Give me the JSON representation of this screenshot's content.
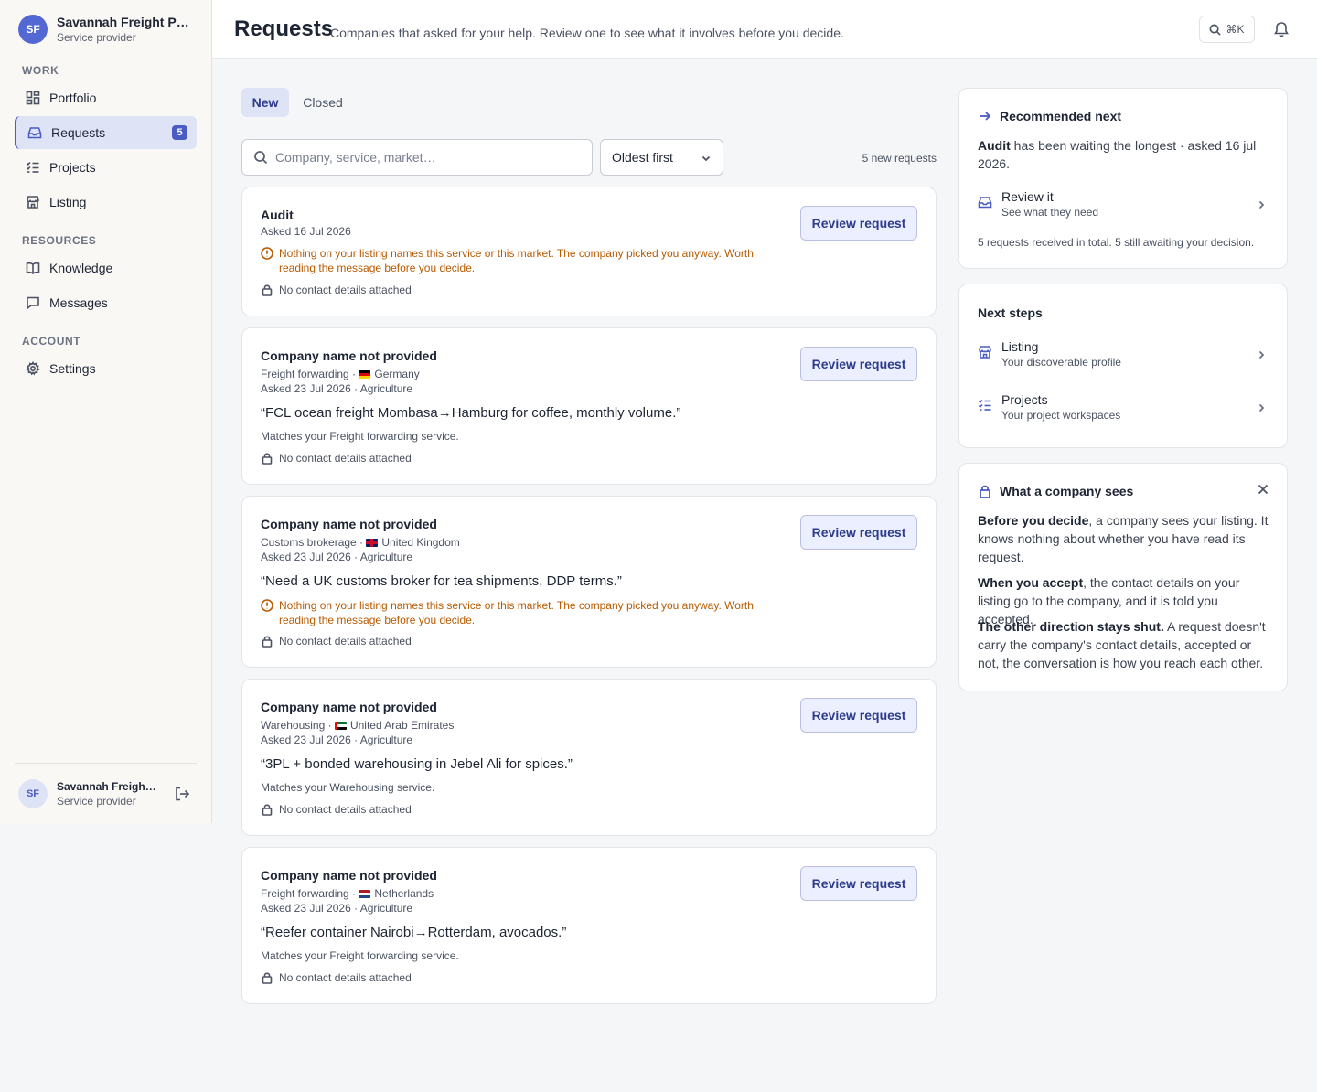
{
  "org": {
    "initials": "SF",
    "name": "Savannah Freight Partners",
    "role": "Service provider"
  },
  "sidebar": {
    "sections": [
      "WORK",
      "RESOURCES",
      "ACCOUNT"
    ],
    "items": [
      {
        "label": "Portfolio",
        "icon": "grid-icon"
      },
      {
        "label": "Requests",
        "icon": "inbox-icon",
        "badge": "5",
        "active": true
      },
      {
        "label": "Projects",
        "icon": "checklist-icon"
      },
      {
        "label": "Listing",
        "icon": "store-icon"
      },
      {
        "label": "Knowledge",
        "icon": "book-icon"
      },
      {
        "label": "Messages",
        "icon": "message-icon"
      },
      {
        "label": "Settings",
        "icon": "gear-icon"
      }
    ]
  },
  "user": {
    "initials": "SF",
    "name": "Savannah Freight Partners",
    "role": "Service provider"
  },
  "header": {
    "title": "Requests",
    "subtitle": "Companies that asked for your help. Review one to see what it involves before you decide.",
    "shortcut": "⌘K"
  },
  "tabs": [
    "New",
    "Closed"
  ],
  "search": {
    "placeholder": "Company, service, market…",
    "value": ""
  },
  "sort": {
    "selected": "Oldest first"
  },
  "count_label": "5 new requests",
  "review_label": "Review request",
  "no_contact": "No contact details attached",
  "warning_text": "Nothing on your listing names this service or this market. The company picked you anyway. Worth reading the message before you decide.",
  "requests": [
    {
      "company": "Audit",
      "asked": "Asked 16 Jul 2026"
    },
    {
      "company": "Company name not provided",
      "service": "Freight forwarding",
      "sep": " · ",
      "country": "Germany",
      "asked": "Asked 23 Jul 2026 · Agriculture",
      "message": "“FCL ocean freight Mombasa→Hamburg for coffee, monthly volume.”",
      "match": "Matches your Freight forwarding service."
    },
    {
      "company": "Company name not provided",
      "service": "Customs brokerage",
      "sep": " · ",
      "country": "United Kingdom",
      "asked": "Asked 23 Jul 2026 · Agriculture",
      "message": "“Need a UK customs broker for tea shipments, DDP terms.”"
    },
    {
      "company": "Company name not provided",
      "service": "Warehousing",
      "sep": " · ",
      "country": "United Arab Emirates",
      "asked": "Asked 23 Jul 2026 · Agriculture",
      "message": "“3PL + bonded warehousing in Jebel Ali for spices.”",
      "match": "Matches your Warehousing service."
    },
    {
      "company": "Company name not provided",
      "service": "Freight forwarding",
      "sep": " · ",
      "country": "Netherlands",
      "asked": "Asked 23 Jul 2026 · Agriculture",
      "message": "“Reefer container Nairobi→Rotterdam, avocados.”",
      "match": "Matches your Freight forwarding service."
    }
  ],
  "recommended": {
    "title": "Recommended next",
    "name": "Audit",
    "text": " has been waiting the longest · asked 16 jul 2026.",
    "row_title": "Review it",
    "row_sub": "See what they need",
    "note": "5 requests received in total. 5 still awaiting your decision."
  },
  "next_steps": {
    "title": "Next steps",
    "items": [
      {
        "title": "Listing",
        "sub": "Your discoverable profile"
      },
      {
        "title": "Projects",
        "sub": "Your project workspaces"
      }
    ]
  },
  "company_sees": {
    "title": "What a company sees",
    "p1_bold": "Before you decide",
    "p1": ", a company sees your listing. It knows nothing about whether you have read its request.",
    "p2_bold": "When you accept",
    "p2": ", the contact details on your listing go to the company, and it is told you accepted.",
    "p3_bold": "The other direction stays shut.",
    "p3": " A request doesn't carry the company's contact details, accepted or not, the conversation is how you reach each other."
  },
  "colors": {
    "accent": "#4a5bc4",
    "warning": "#b85a00",
    "active_bg": "#dfe3f6"
  }
}
